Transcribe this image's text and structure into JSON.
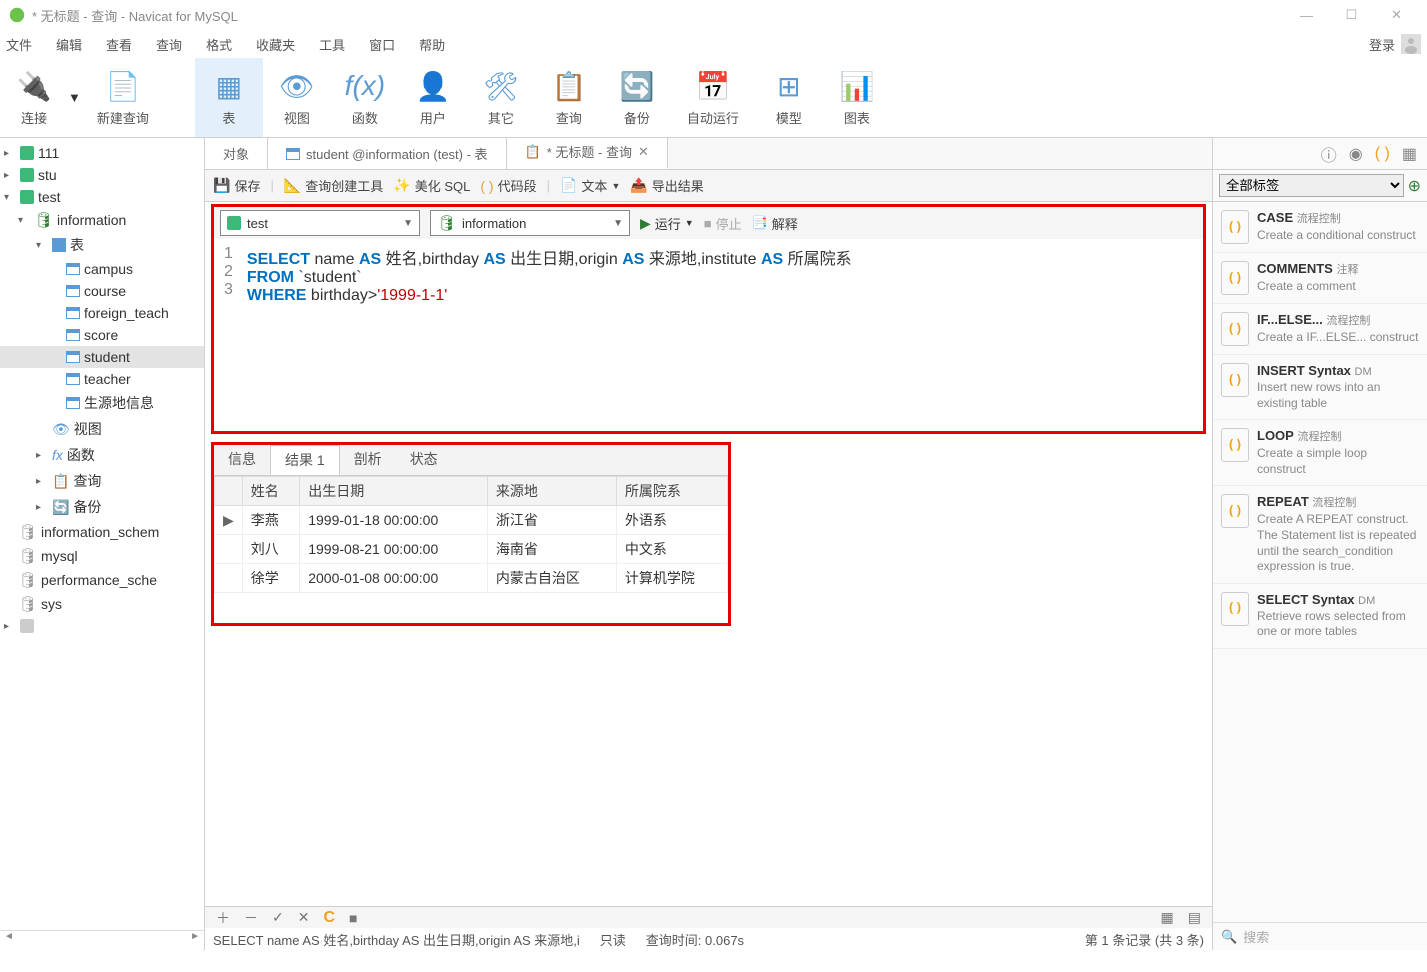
{
  "titlebar": {
    "title": "* 无标题 - 查询 - Navicat for MySQL"
  },
  "menu": {
    "file": "文件",
    "edit": "编辑",
    "view": "查看",
    "query": "查询",
    "format": "格式",
    "favorites": "收藏夹",
    "tools": "工具",
    "window": "窗口",
    "help": "帮助",
    "login": "登录"
  },
  "toolbar": {
    "connection": "连接",
    "new_query": "新建查询",
    "table": "表",
    "view": "视图",
    "function": "函数",
    "user": "用户",
    "other": "其它",
    "query": "查询",
    "backup": "备份",
    "auto_run": "自动运行",
    "model": "模型",
    "chart": "图表"
  },
  "sidebar": {
    "conn1": "111",
    "conn2": "stu",
    "conn3": "test",
    "db1": "information",
    "folder_table": "表",
    "tables": [
      "campus",
      "course",
      "foreign_teach",
      "score",
      "student",
      "teacher",
      "生源地信息"
    ],
    "views": "视图",
    "functions": "函数",
    "queries": "查询",
    "backups": "备份",
    "db2": "information_schem",
    "db3": "mysql",
    "db4": "performance_sche",
    "db5": "sys"
  },
  "tabs": {
    "objects": "对象",
    "student_table": "student @information (test) - 表",
    "query_tab": "* 无标题 - 查询"
  },
  "query_toolbar": {
    "save": "保存",
    "query_builder": "查询创建工具",
    "beautify_sql": "美化 SQL",
    "code_snippet": "代码段",
    "text": "文本",
    "export": "导出结果"
  },
  "conn_select": {
    "conn": "test",
    "db": "information"
  },
  "actions": {
    "run": "运行",
    "stop": "停止",
    "explain": "解释"
  },
  "sql": {
    "line1a": "SELECT",
    "line1b": "name",
    "line1c": "AS",
    "line1d": "姓名,birthday",
    "line1e": "AS",
    "line1f": "出生日期,origin",
    "line1g": "AS",
    "line1h": "来源地,institute",
    "line1i": "AS",
    "line1j": "所属院系",
    "line2a": "FROM",
    "line2b": "`student`",
    "line3a": "WHERE",
    "line3b": " birthday>",
    "line3c": "'1999-1-1'"
  },
  "result_tabs": {
    "info": "信息",
    "result": "结果 1",
    "analyze": "剖析",
    "status": "状态"
  },
  "result_headers": [
    "姓名",
    "出生日期",
    "来源地",
    "所属院系"
  ],
  "result_rows": [
    {
      "name": "李燕",
      "birth": "1999-01-18 00:00:00",
      "origin": "浙江省",
      "inst": "外语系"
    },
    {
      "name": "刘八",
      "birth": "1999-08-21 00:00:00",
      "origin": "海南省",
      "inst": "中文系"
    },
    {
      "name": "徐学",
      "birth": "2000-01-08 00:00:00",
      "origin": "内蒙古自治区",
      "inst": "计算机学院"
    }
  ],
  "rp_filter": "全部标签",
  "snippets": [
    {
      "title": "CASE",
      "cat": "流程控制",
      "desc": "Create a conditional construct"
    },
    {
      "title": "COMMENTS",
      "cat": "注释",
      "desc": "Create a comment"
    },
    {
      "title": "IF...ELSE...",
      "cat": "流程控制",
      "desc": "Create a IF...ELSE... construct"
    },
    {
      "title": "INSERT Syntax",
      "cat": "DM",
      "desc": "Insert new rows into an existing table"
    },
    {
      "title": "LOOP",
      "cat": "流程控制",
      "desc": "Create a simple loop construct"
    },
    {
      "title": "REPEAT",
      "cat": "流程控制",
      "desc": "Create A REPEAT construct. The Statement list is repeated until the search_condition expression is true."
    },
    {
      "title": "SELECT Syntax",
      "cat": "DM",
      "desc": "Retrieve rows selected from one or more tables"
    }
  ],
  "rp_search": "搜索",
  "status": {
    "sql_preview": "SELECT name AS 姓名,birthday AS 出生日期,origin AS 来源地,i",
    "mode": "只读",
    "time": "查询时间: 0.067s",
    "record": "第 1 条记录 (共 3 条)"
  }
}
